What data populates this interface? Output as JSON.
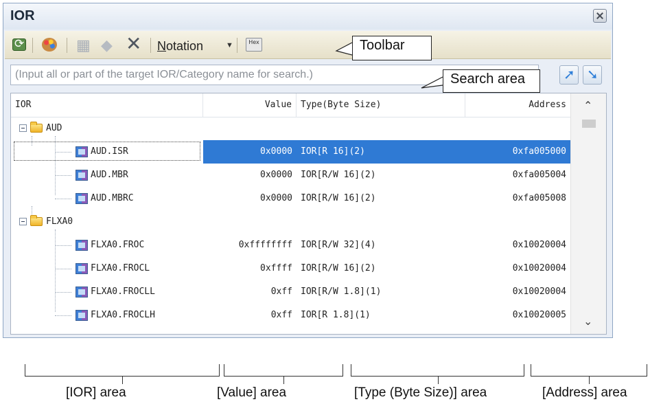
{
  "window": {
    "title": "IOR"
  },
  "toolbar": {
    "notation_label": "Notation",
    "notation_underline": "N",
    "notation_rest": "otation",
    "icons": [
      "refresh-icon",
      "palette-icon",
      "register-watch-icon",
      "eraser-icon",
      "delete-icon",
      "hex-display-icon"
    ]
  },
  "search": {
    "placeholder": "(Input all or part of the target IOR/Category name for search.)"
  },
  "columns": {
    "ior": "IOR",
    "value": "Value",
    "type": "Type(Byte Size)",
    "address": "Address"
  },
  "rows": [
    {
      "kind": "category",
      "name": "AUD"
    },
    {
      "kind": "register",
      "name": "AUD.ISR",
      "value": "0x0000",
      "type": "IOR[R 16](2)",
      "address": "0xfa005000",
      "selected": true
    },
    {
      "kind": "register",
      "name": "AUD.MBR",
      "value": "0x0000",
      "type": "IOR[R/W 16](2)",
      "address": "0xfa005004"
    },
    {
      "kind": "register",
      "name": "AUD.MBRC",
      "value": "0x0000",
      "type": "IOR[R/W 16](2)",
      "address": "0xfa005008"
    },
    {
      "kind": "category",
      "name": "FLXA0"
    },
    {
      "kind": "register",
      "name": "FLXA0.FROC",
      "value": "0xffffffff",
      "type": "IOR[R/W 32](4)",
      "address": "0x10020004"
    },
    {
      "kind": "register",
      "name": "FLXA0.FROCL",
      "value": "0xffff",
      "type": "IOR[R/W 16](2)",
      "address": "0x10020004"
    },
    {
      "kind": "register",
      "name": "FLXA0.FROCLL",
      "value": "0xff",
      "type": "IOR[R/W 1.8](1)",
      "address": "0x10020004"
    },
    {
      "kind": "register",
      "name": "FLXA0.FROCLH",
      "value": "0xff",
      "type": "IOR[R 1.8](1)",
      "address": "0x10020005"
    }
  ],
  "callouts": {
    "toolbar": "Toolbar",
    "search_area": "Search area"
  },
  "areas": {
    "ior": "[IOR] area",
    "value": "[Value] area",
    "type": "[Type (Byte Size)] area",
    "address": "[Address] area"
  },
  "colors": {
    "selection": "#2f7ad4",
    "title_bar": "#dfe7f2",
    "toolbar_bg": "#e6e0c9"
  }
}
